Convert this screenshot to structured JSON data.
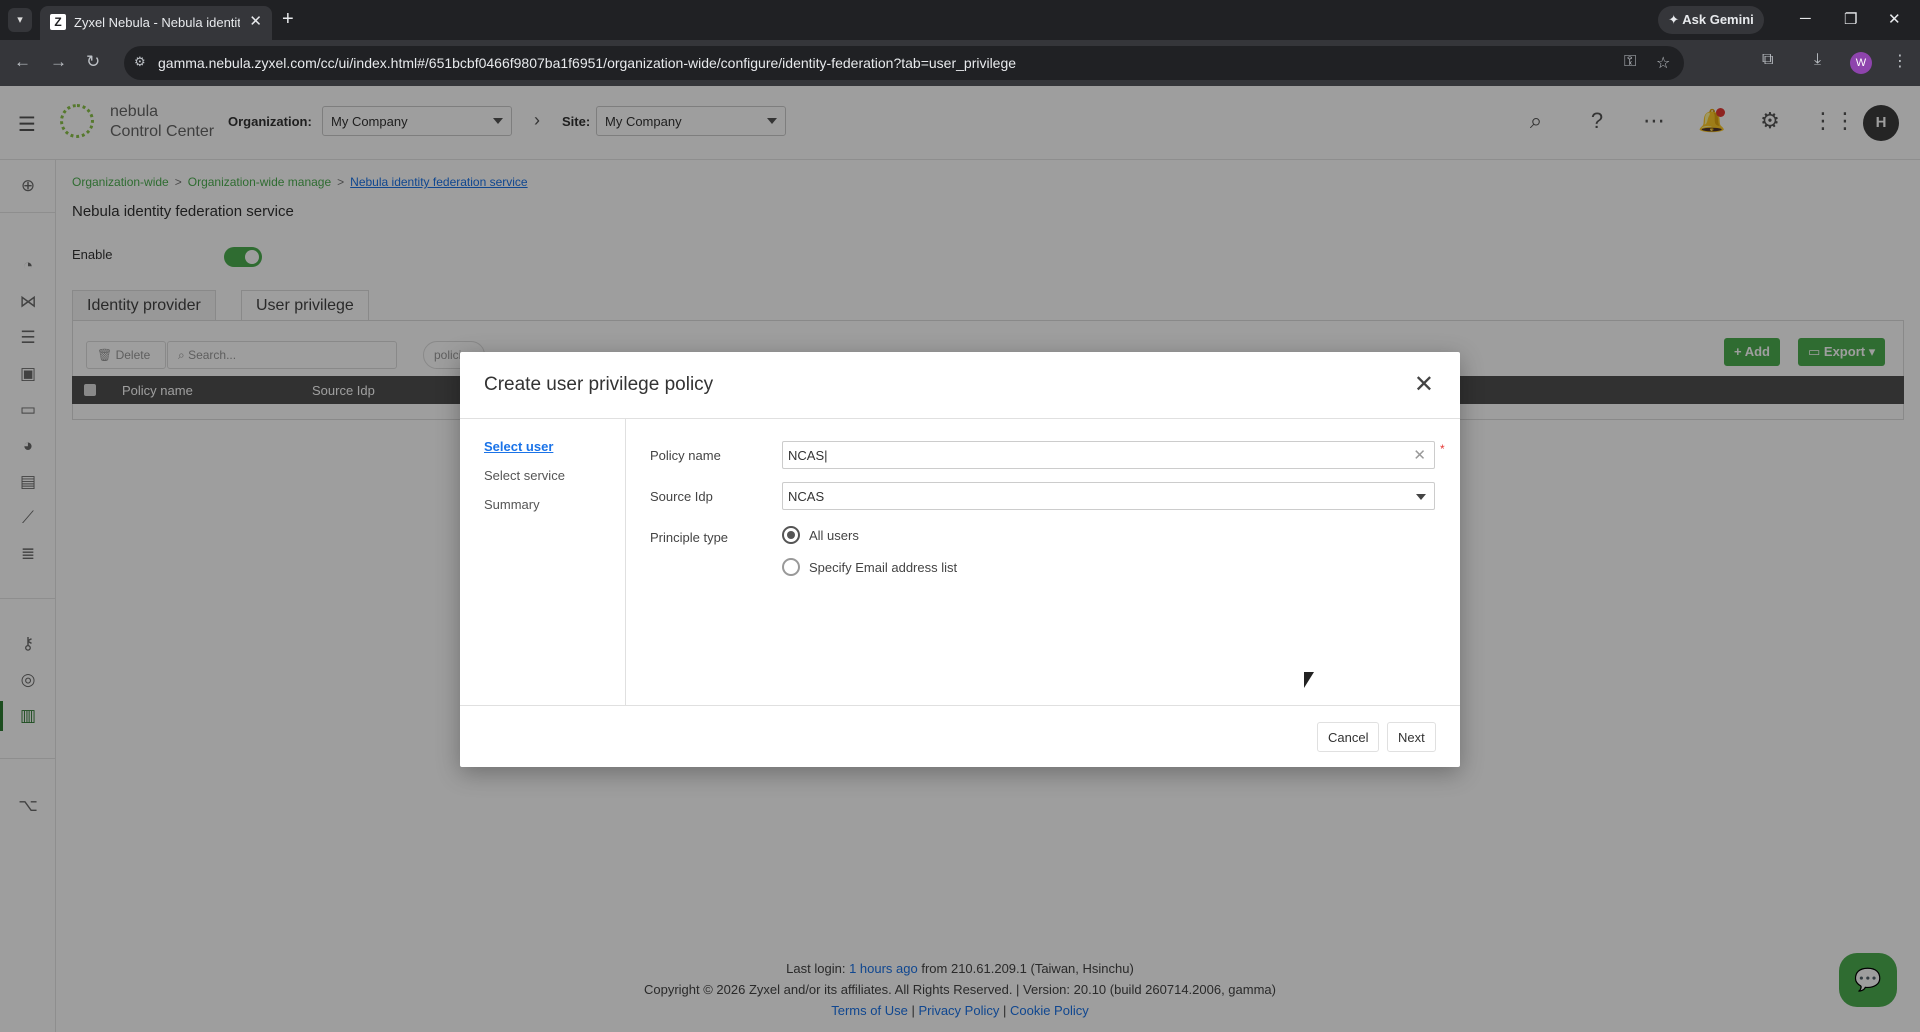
{
  "browser": {
    "tab_title": "Zyxel Nebula - Nebula identity",
    "url": "gamma.nebula.zyxel.com/cc/ui/index.html#/651bcbf0466f9807ba1f6951/organization-wide/configure/identity-federation?tab=user_privilege",
    "ask_gemini": "Ask Gemini",
    "profile_initial": "W"
  },
  "header": {
    "brand_line1": "nebula",
    "brand_line2": "Control Center",
    "org_label": "Organization:",
    "org_value": "My Company",
    "site_label": "Site:",
    "site_value": "My Company",
    "avatar_initial": "H"
  },
  "page": {
    "breadcrumb": [
      "Organization-wide",
      "Organization-wide manage",
      "Nebula identity federation service"
    ],
    "title": "Nebula identity federation service",
    "enable_label": "Enable",
    "enabled": true,
    "tabs": [
      "Identity provider",
      "User privilege"
    ],
    "active_tab": "User privilege",
    "toolbar": {
      "delete": "Delete",
      "search_placeholder": "Search...",
      "policies": "policies",
      "add": "+ Add",
      "export": "Export"
    },
    "table_headers": [
      "Policy name",
      "Source Idp"
    ]
  },
  "modal": {
    "title": "Create user privilege policy",
    "steps": [
      "Select user",
      "Select service",
      "Summary"
    ],
    "active_step": "Select user",
    "policy_name_label": "Policy name",
    "policy_name_value": "NCAS",
    "source_idp_label": "Source Idp",
    "source_idp_value": "NCAS",
    "principle_type_label": "Principle type",
    "principle_options": [
      "All users",
      "Specify Email address list"
    ],
    "principle_selected": "All users",
    "cancel": "Cancel",
    "next": "Next"
  },
  "footer": {
    "last_login_prefix": "Last login:",
    "last_login_link": "1 hours ago",
    "last_login_suffix": "from 210.61.209.1 (Taiwan, Hsinchu)",
    "copyright": "Copyright © 2026 Zyxel and/or its affiliates. All Rights Reserved. | Version: 20.10 (build 260714.2006, gamma)",
    "links": [
      "Terms of Use",
      "Privacy Policy",
      "Cookie Policy"
    ]
  },
  "colors": {
    "accent_green": "#4caf50",
    "link_blue": "#1a73e8",
    "required_red": "#e53935"
  }
}
